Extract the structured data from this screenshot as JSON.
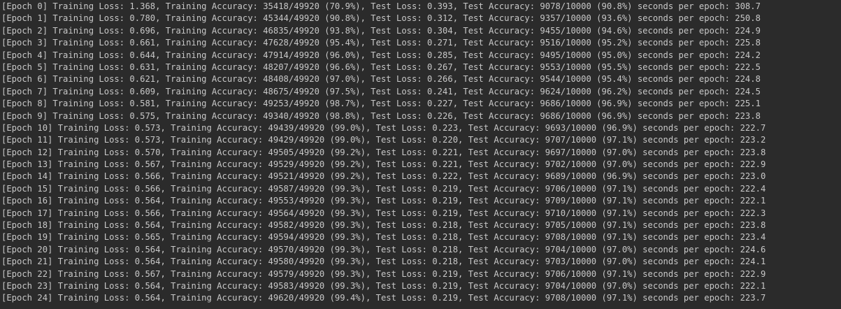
{
  "console": {
    "lines": [
      "[Epoch 0] Training Loss: 1.368, Training Accuracy: 35418/49920 (70.9%), Test Loss: 0.393, Test Accuracy: 9078/10000 (90.8%) seconds per epoch: 308.7",
      "[Epoch 1] Training Loss: 0.780, Training Accuracy: 45344/49920 (90.8%), Test Loss: 0.312, Test Accuracy: 9357/10000 (93.6%) seconds per epoch: 250.8",
      "[Epoch 2] Training Loss: 0.696, Training Accuracy: 46835/49920 (93.8%), Test Loss: 0.304, Test Accuracy: 9455/10000 (94.6%) seconds per epoch: 224.9",
      "[Epoch 3] Training Loss: 0.661, Training Accuracy: 47628/49920 (95.4%), Test Loss: 0.271, Test Accuracy: 9516/10000 (95.2%) seconds per epoch: 225.8",
      "[Epoch 4] Training Loss: 0.644, Training Accuracy: 47914/49920 (96.0%), Test Loss: 0.285, Test Accuracy: 9495/10000 (95.0%) seconds per epoch: 224.2",
      "[Epoch 5] Training Loss: 0.631, Training Accuracy: 48207/49920 (96.6%), Test Loss: 0.267, Test Accuracy: 9553/10000 (95.5%) seconds per epoch: 222.5",
      "[Epoch 6] Training Loss: 0.621, Training Accuracy: 48408/49920 (97.0%), Test Loss: 0.266, Test Accuracy: 9544/10000 (95.4%) seconds per epoch: 224.8",
      "[Epoch 7] Training Loss: 0.609, Training Accuracy: 48675/49920 (97.5%), Test Loss: 0.241, Test Accuracy: 9624/10000 (96.2%) seconds per epoch: 224.5",
      "[Epoch 8] Training Loss: 0.581, Training Accuracy: 49253/49920 (98.7%), Test Loss: 0.227, Test Accuracy: 9686/10000 (96.9%) seconds per epoch: 225.1",
      "[Epoch 9] Training Loss: 0.575, Training Accuracy: 49340/49920 (98.8%), Test Loss: 0.226, Test Accuracy: 9686/10000 (96.9%) seconds per epoch: 223.8",
      "[Epoch 10] Training Loss: 0.573, Training Accuracy: 49439/49920 (99.0%), Test Loss: 0.223, Test Accuracy: 9693/10000 (96.9%) seconds per epoch: 222.7",
      "[Epoch 11] Training Loss: 0.573, Training Accuracy: 49429/49920 (99.0%), Test Loss: 0.220, Test Accuracy: 9707/10000 (97.1%) seconds per epoch: 223.2",
      "[Epoch 12] Training Loss: 0.570, Training Accuracy: 49505/49920 (99.2%), Test Loss: 0.221, Test Accuracy: 9697/10000 (97.0%) seconds per epoch: 223.8",
      "[Epoch 13] Training Loss: 0.567, Training Accuracy: 49529/49920 (99.2%), Test Loss: 0.221, Test Accuracy: 9702/10000 (97.0%) seconds per epoch: 222.9",
      "[Epoch 14] Training Loss: 0.566, Training Accuracy: 49521/49920 (99.2%), Test Loss: 0.222, Test Accuracy: 9689/10000 (96.9%) seconds per epoch: 223.0",
      "[Epoch 15] Training Loss: 0.566, Training Accuracy: 49587/49920 (99.3%), Test Loss: 0.219, Test Accuracy: 9706/10000 (97.1%) seconds per epoch: 222.4",
      "[Epoch 16] Training Loss: 0.564, Training Accuracy: 49553/49920 (99.3%), Test Loss: 0.219, Test Accuracy: 9709/10000 (97.1%) seconds per epoch: 222.1",
      "[Epoch 17] Training Loss: 0.566, Training Accuracy: 49564/49920 (99.3%), Test Loss: 0.219, Test Accuracy: 9710/10000 (97.1%) seconds per epoch: 222.3",
      "[Epoch 18] Training Loss: 0.564, Training Accuracy: 49582/49920 (99.3%), Test Loss: 0.218, Test Accuracy: 9705/10000 (97.1%) seconds per epoch: 223.8",
      "[Epoch 19] Training Loss: 0.565, Training Accuracy: 49594/49920 (99.3%), Test Loss: 0.218, Test Accuracy: 9708/10000 (97.1%) seconds per epoch: 223.4",
      "[Epoch 20] Training Loss: 0.564, Training Accuracy: 49570/49920 (99.3%), Test Loss: 0.218, Test Accuracy: 9704/10000 (97.0%) seconds per epoch: 224.6",
      "[Epoch 21] Training Loss: 0.564, Training Accuracy: 49580/49920 (99.3%), Test Loss: 0.218, Test Accuracy: 9703/10000 (97.0%) seconds per epoch: 224.1",
      "[Epoch 22] Training Loss: 0.567, Training Accuracy: 49579/49920 (99.3%), Test Loss: 0.219, Test Accuracy: 9706/10000 (97.1%) seconds per epoch: 222.9",
      "[Epoch 23] Training Loss: 0.564, Training Accuracy: 49583/49920 (99.3%), Test Loss: 0.219, Test Accuracy: 9704/10000 (97.0%) seconds per epoch: 222.1",
      "[Epoch 24] Training Loss: 0.564, Training Accuracy: 49620/49920 (99.4%), Test Loss: 0.219, Test Accuracy: 9708/10000 (97.1%) seconds per epoch: 223.7"
    ]
  },
  "colors": {
    "background": "#2b2b2b",
    "text": "#c8c8c8"
  }
}
